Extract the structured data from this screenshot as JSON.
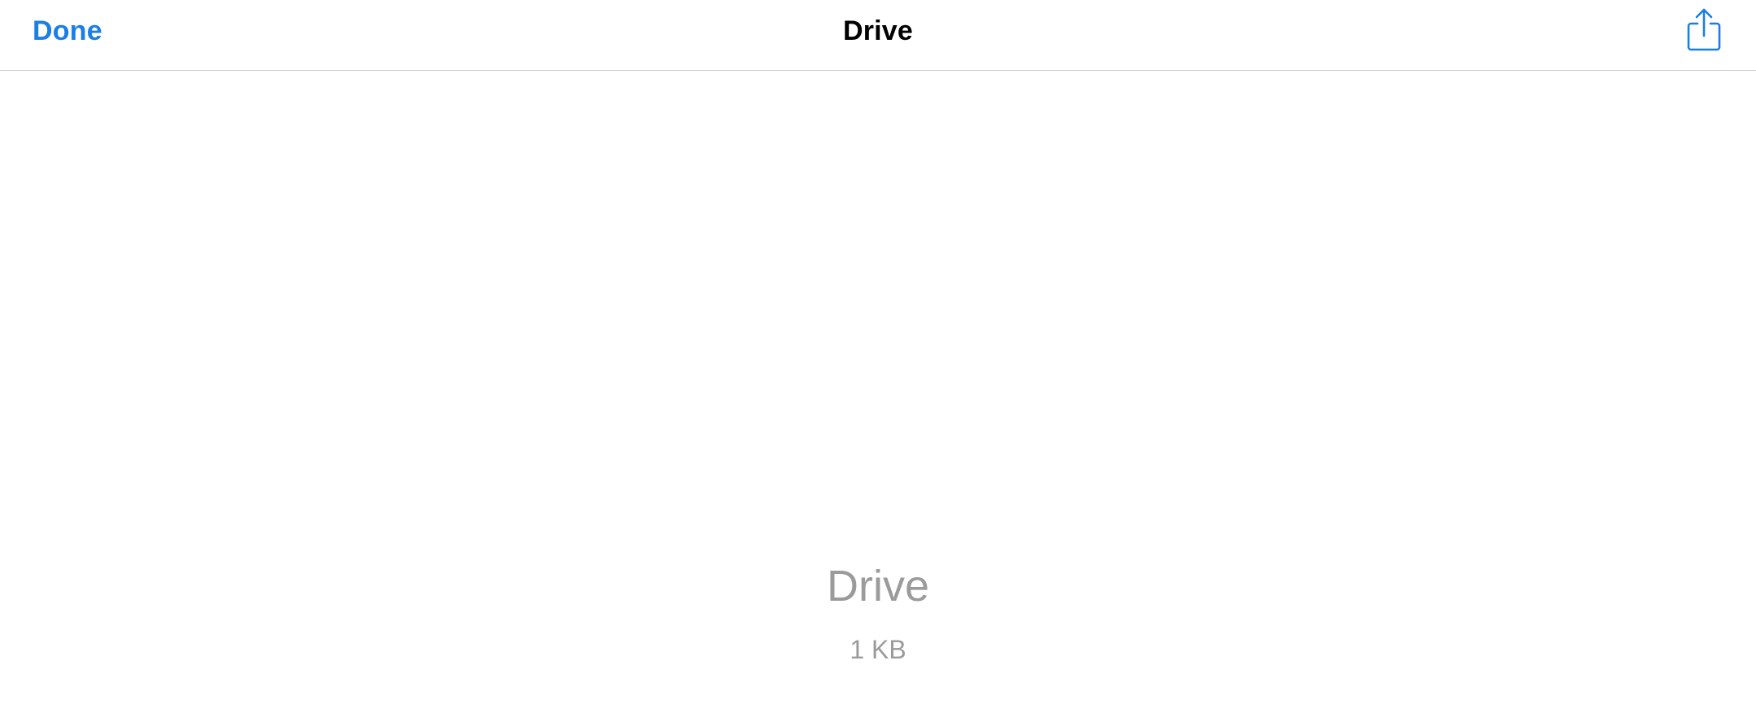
{
  "navbar": {
    "done_label": "Done",
    "title": "Drive",
    "share_icon": "share-icon",
    "accent_color": "#1a7ee6"
  },
  "preview": {
    "file_name": "Drive",
    "file_size": "1 KB"
  }
}
